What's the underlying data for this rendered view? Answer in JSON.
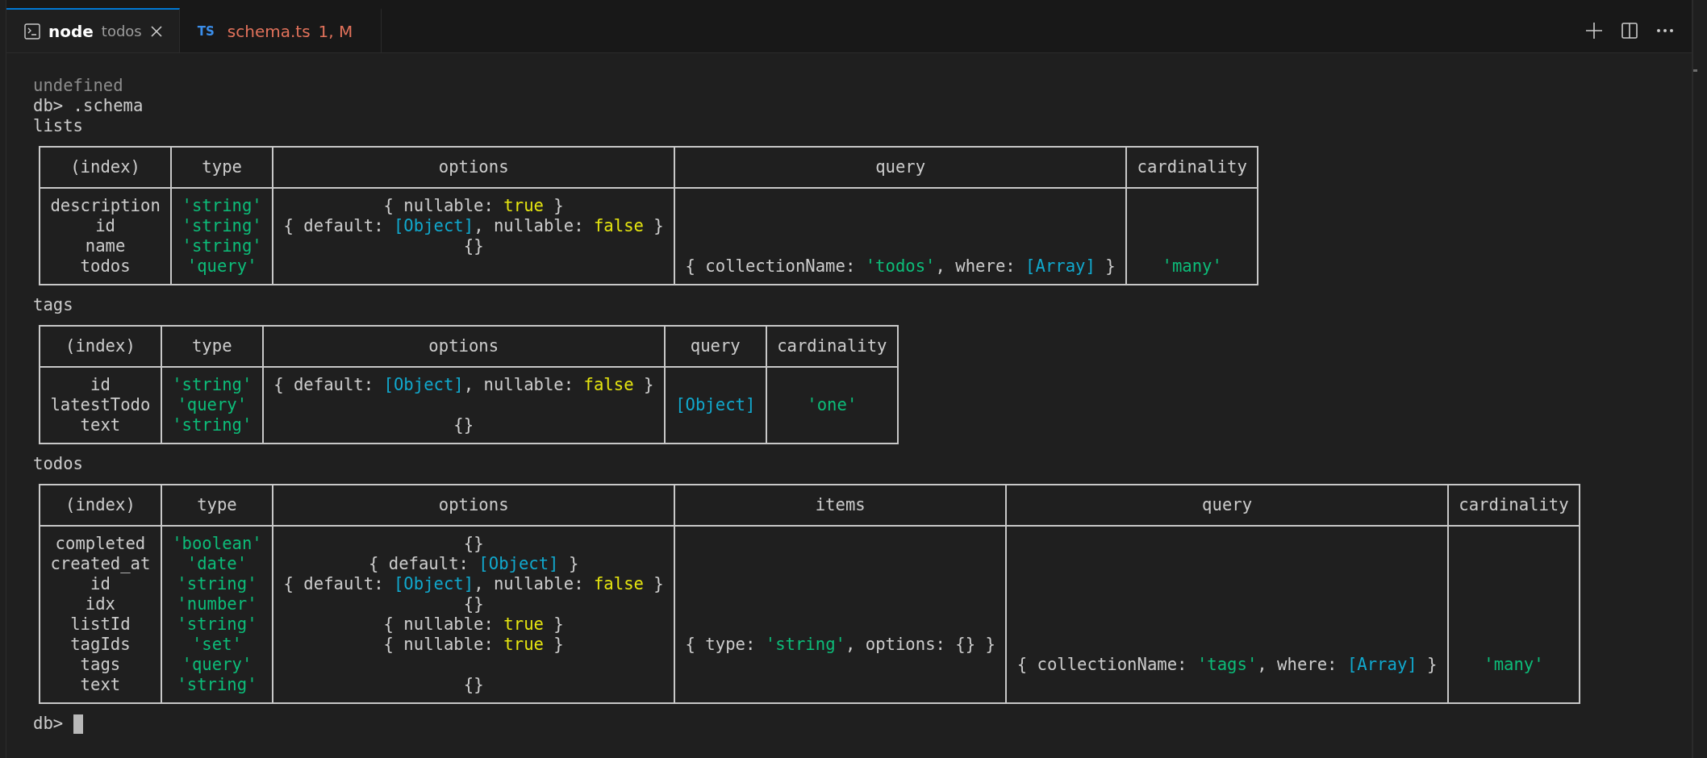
{
  "tabs": [
    {
      "kind": "terminal",
      "label": "node",
      "detail": "todos",
      "selected": true,
      "closable": true
    },
    {
      "kind": "file",
      "badge": "TS",
      "label": "schema.ts",
      "detail": "1, M",
      "selected": false,
      "closable": false
    }
  ],
  "terminal": [
    {
      "kind": "line",
      "text": "undefined",
      "muted": true
    },
    {
      "kind": "line",
      "text": "db> .schema",
      "muted": false
    },
    {
      "kind": "line",
      "text": "lists",
      "muted": false
    },
    {
      "kind": "table",
      "columns": [
        "(index)",
        "type",
        "options",
        "query",
        "cardinality"
      ],
      "rows": [
        [
          "description",
          [
            {
              "text": "'string'",
              "kind": "string"
            }
          ],
          [
            {
              "text": "{ nullable: ",
              "kind": "plain"
            },
            {
              "text": "true",
              "kind": "boolean"
            },
            {
              "text": " }",
              "kind": "plain"
            }
          ],
          null,
          null
        ],
        [
          "id",
          [
            {
              "text": "'string'",
              "kind": "string"
            }
          ],
          [
            {
              "text": "{ default: ",
              "kind": "plain"
            },
            {
              "text": "[Object]",
              "kind": "special"
            },
            {
              "text": ", nullable: ",
              "kind": "plain"
            },
            {
              "text": "false",
              "kind": "boolean"
            },
            {
              "text": " }",
              "kind": "plain"
            }
          ],
          null,
          null
        ],
        [
          "name",
          [
            {
              "text": "'string'",
              "kind": "string"
            }
          ],
          "{}",
          null,
          null
        ],
        [
          "todos",
          [
            {
              "text": "'query'",
              "kind": "string"
            }
          ],
          null,
          [
            {
              "text": "{ collectionName: ",
              "kind": "plain"
            },
            {
              "text": "'todos'",
              "kind": "string"
            },
            {
              "text": ", where: ",
              "kind": "plain"
            },
            {
              "text": "[Array]",
              "kind": "special"
            },
            {
              "text": " }",
              "kind": "plain"
            }
          ],
          [
            {
              "text": "'many'",
              "kind": "string"
            }
          ]
        ]
      ]
    },
    {
      "kind": "line",
      "text": "tags",
      "muted": false
    },
    {
      "kind": "table",
      "columns": [
        "(index)",
        "type",
        "options",
        "query",
        "cardinality"
      ],
      "rows": [
        [
          "id",
          [
            {
              "text": "'string'",
              "kind": "string"
            }
          ],
          [
            {
              "text": "{ default: ",
              "kind": "plain"
            },
            {
              "text": "[Object]",
              "kind": "special"
            },
            {
              "text": ", nullable: ",
              "kind": "plain"
            },
            {
              "text": "false",
              "kind": "boolean"
            },
            {
              "text": " }",
              "kind": "plain"
            }
          ],
          null,
          null
        ],
        [
          "latestTodo",
          [
            {
              "text": "'query'",
              "kind": "string"
            }
          ],
          null,
          [
            {
              "text": "[Object]",
              "kind": "special"
            }
          ],
          [
            {
              "text": "'one'",
              "kind": "string"
            }
          ]
        ],
        [
          "text",
          [
            {
              "text": "'string'",
              "kind": "string"
            }
          ],
          "{}",
          null,
          null
        ]
      ]
    },
    {
      "kind": "line",
      "text": "todos",
      "muted": false
    },
    {
      "kind": "table",
      "columns": [
        "(index)",
        "type",
        "options",
        "items",
        "query",
        "cardinality"
      ],
      "rows": [
        [
          "completed",
          [
            {
              "text": "'boolean'",
              "kind": "string"
            }
          ],
          "{}",
          null,
          null,
          null
        ],
        [
          "created_at",
          [
            {
              "text": "'date'",
              "kind": "string"
            }
          ],
          [
            {
              "text": "{ default: ",
              "kind": "plain"
            },
            {
              "text": "[Object]",
              "kind": "special"
            },
            {
              "text": " }",
              "kind": "plain"
            }
          ],
          null,
          null,
          null
        ],
        [
          "id",
          [
            {
              "text": "'string'",
              "kind": "string"
            }
          ],
          [
            {
              "text": "{ default: ",
              "kind": "plain"
            },
            {
              "text": "[Object]",
              "kind": "special"
            },
            {
              "text": ", nullable: ",
              "kind": "plain"
            },
            {
              "text": "false",
              "kind": "boolean"
            },
            {
              "text": " }",
              "kind": "plain"
            }
          ],
          null,
          null,
          null
        ],
        [
          "idx",
          [
            {
              "text": "'number'",
              "kind": "string"
            }
          ],
          "{}",
          null,
          null,
          null
        ],
        [
          "listId",
          [
            {
              "text": "'string'",
              "kind": "string"
            }
          ],
          [
            {
              "text": "{ nullable: ",
              "kind": "plain"
            },
            {
              "text": "true",
              "kind": "boolean"
            },
            {
              "text": " }",
              "kind": "plain"
            }
          ],
          null,
          null,
          null
        ],
        [
          "tagIds",
          [
            {
              "text": "'set'",
              "kind": "string"
            }
          ],
          [
            {
              "text": "{ nullable: ",
              "kind": "plain"
            },
            {
              "text": "true",
              "kind": "boolean"
            },
            {
              "text": " }",
              "kind": "plain"
            }
          ],
          [
            {
              "text": "{ type: ",
              "kind": "plain"
            },
            {
              "text": "'string'",
              "kind": "string"
            },
            {
              "text": ", options: {} }",
              "kind": "plain"
            }
          ],
          null,
          null
        ],
        [
          "tags",
          [
            {
              "text": "'query'",
              "kind": "string"
            }
          ],
          null,
          null,
          [
            {
              "text": "{ collectionName: ",
              "kind": "plain"
            },
            {
              "text": "'tags'",
              "kind": "string"
            },
            {
              "text": ", where: ",
              "kind": "plain"
            },
            {
              "text": "[Array]",
              "kind": "special"
            },
            {
              "text": " }",
              "kind": "plain"
            }
          ],
          [
            {
              "text": "'many'",
              "kind": "string"
            }
          ]
        ],
        [
          "text",
          [
            {
              "text": "'string'",
              "kind": "string"
            }
          ],
          "{}",
          null,
          null,
          null
        ]
      ]
    },
    {
      "kind": "prompt",
      "text": "db>",
      "cursor": true
    }
  ]
}
